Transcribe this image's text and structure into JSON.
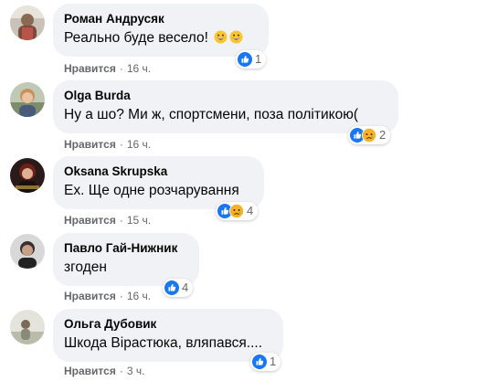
{
  "like_label": "Нравится",
  "separator": "·",
  "colors": {
    "bubble": "#f0f2f5",
    "secondary_text": "#65676b",
    "like_blue": "#1877f2",
    "emoji_yellow": "#f7b125"
  },
  "comments": [
    {
      "author": "Роман Андрусяк",
      "text": "Реально буде весело!",
      "text_emoji": [
        "grinning-emoji",
        "grinning-emoji"
      ],
      "reactions": [
        "like"
      ],
      "reaction_count": "1",
      "time": "16 ч."
    },
    {
      "author": "Olga Burda",
      "text": "Ну а шо? Ми ж, спортсмени, поза політикою(",
      "reactions": [
        "like",
        "sad"
      ],
      "reaction_count": "2",
      "time": "16 ч."
    },
    {
      "author": "Oksana Skrupska",
      "text": "Ех. Ще одне розчарування",
      "reactions": [
        "like",
        "sad"
      ],
      "reaction_count": "4",
      "time": "15 ч."
    },
    {
      "author": "Павло Гай-Нижник",
      "text": "згоден",
      "reactions": [
        "like"
      ],
      "reaction_count": "4",
      "time": "16 ч."
    },
    {
      "author": "Ольга Дубовик",
      "text": "Шкода Вірастюка, вляпався....",
      "reactions": [
        "like"
      ],
      "reaction_count": "1",
      "time": "3 ч."
    }
  ]
}
